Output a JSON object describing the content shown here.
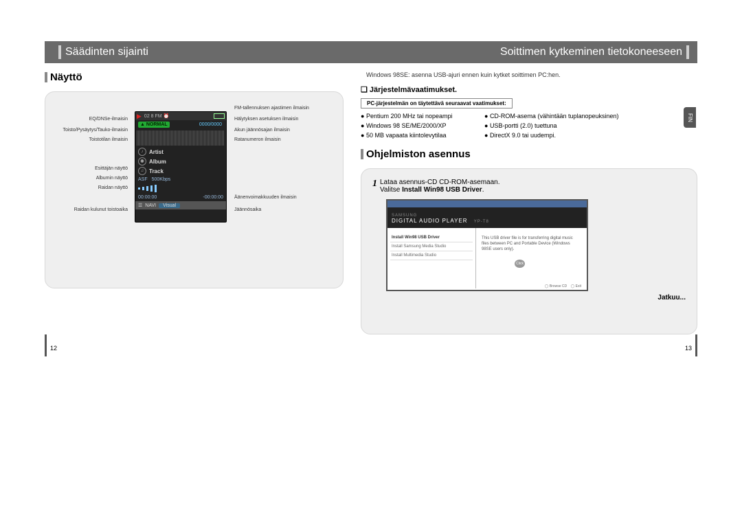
{
  "header": {
    "left_title": "Säädinten sijainti",
    "right_title": "Soittimen kytkeminen tietokoneeseen"
  },
  "left": {
    "section": "Näyttö",
    "labels": {
      "eq": "EQ/DNSe-ilmaisin",
      "play": "Toisto/Pysäytys/Tauko-ilmaisin",
      "repeat": "Toistotilan ilmaisin",
      "artist": "Esittäjän näyttö",
      "album": "Albumin näyttö",
      "track": "Raidan näyttö",
      "elapsed": "Raidan kulunut toistoaika",
      "fm": "FM-tallennuksen ajastimen ilmaisin",
      "alarm": "Hälytyksen asetuksen ilmaisin",
      "battery": "Akun jäännösajan ilmaisin",
      "tracknum": "Ratanumeron ilmaisin",
      "volume": "Äänenvoimakkuuden ilmaisin",
      "remain": "Jäännösaika"
    },
    "device": {
      "topicons": "02 8 FM ⏰",
      "normal": "▲ NORMAL",
      "trackcount": "0000/0000",
      "artist": "Artist",
      "album": "Album",
      "track": "Track",
      "asf": "ASF",
      "kbps": "500Kbps",
      "t1": "00:00:00",
      "t2": "-00:00:00",
      "navi": "NAVI",
      "visual": "Visual",
      "play": "▶"
    },
    "page": "12"
  },
  "right": {
    "note": "Windows 98SE: asenna USB-ajuri ennen kuin kytket soittimen PC:hen.",
    "sys_h": "Järjestelmävaatimukset.",
    "req_box": "PC-järjestelmän on täytettävä seuraavat vaatimukset:",
    "bullets": [
      "Pentium 200 MHz tai nopeampi",
      "CD-ROM-asema (vähintään tuplanopeuksinen)",
      "Windows 98 SE/ME/2000/XP",
      "USB-portti (2.0) tuettuna",
      "50 MB vapaata kiintolevytilaa",
      "DirectX 9.0 tai uudempi."
    ],
    "fin": "FIN",
    "section2": "Ohjelmiston asennus",
    "step1": "Lataa asennus-CD CD-ROM-asemaan.",
    "step1b_pre": "Valitse ",
    "step1b_bold": "Install Win98 USB Driver",
    "step1b_post": ".",
    "installer": {
      "brand": "SAMSUNG",
      "title": "DIGITAL AUDIO PLAYER",
      "sub": "YP-T8",
      "menu1": "Install Win98 USB Driver",
      "menu2": "Install Samsung Media Studio",
      "menu3": "Install Multimedia Studio",
      "desc": "This USB driver file is for transferring digital music files between PC and Portable Device (Windows 98SE users only).",
      "click": "Click",
      "browse": "Browse CD",
      "exit": "Exit"
    },
    "jatkuu": "Jatkuu...",
    "page": "13"
  }
}
